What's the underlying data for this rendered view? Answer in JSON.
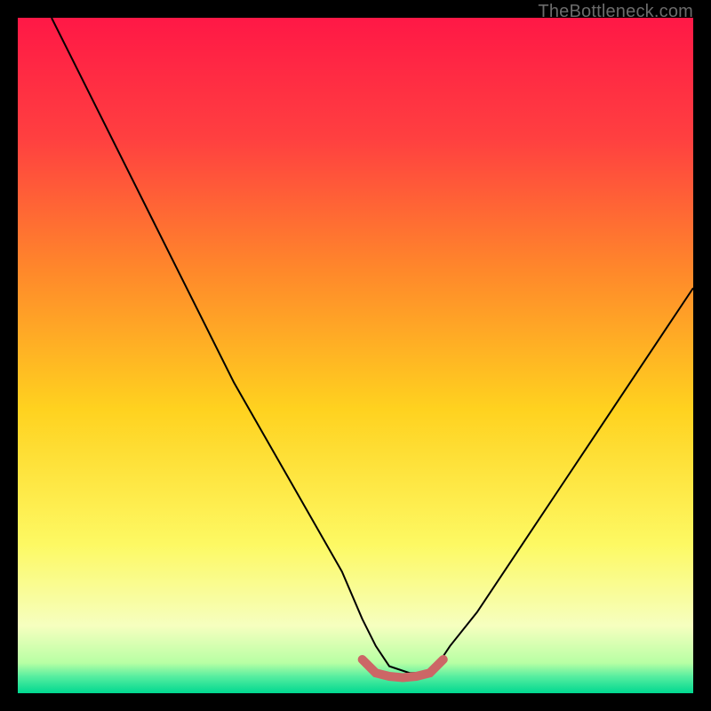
{
  "watermark": "TheBottleneck.com",
  "chart_data": {
    "type": "line",
    "title": "",
    "xlabel": "",
    "ylabel": "",
    "xlim": [
      0,
      100
    ],
    "ylim": [
      0,
      100
    ],
    "grid": false,
    "gradient_stops": [
      {
        "pos": 0.0,
        "color": "#ff1846"
      },
      {
        "pos": 0.18,
        "color": "#ff4040"
      },
      {
        "pos": 0.38,
        "color": "#ff8a2a"
      },
      {
        "pos": 0.58,
        "color": "#ffd21f"
      },
      {
        "pos": 0.78,
        "color": "#fdf963"
      },
      {
        "pos": 0.9,
        "color": "#f6ffbf"
      },
      {
        "pos": 0.955,
        "color": "#b8ffa4"
      },
      {
        "pos": 0.975,
        "color": "#58eea0"
      },
      {
        "pos": 1.0,
        "color": "#00d890"
      }
    ],
    "series": [
      {
        "name": "bottleneck-curve",
        "stroke": "#000000",
        "stroke_width": 2,
        "x": [
          5,
          8,
          12,
          16,
          20,
          24,
          28,
          32,
          36,
          40,
          44,
          48,
          51,
          53,
          55,
          58,
          60,
          62,
          64,
          68,
          72,
          76,
          80,
          84,
          88,
          92,
          96,
          100
        ],
        "values": [
          100,
          94,
          86,
          78,
          70,
          62,
          54,
          46,
          39,
          32,
          25,
          18,
          11,
          7,
          4,
          3,
          3,
          4,
          7,
          12,
          18,
          24,
          30,
          36,
          42,
          48,
          54,
          60
        ]
      },
      {
        "name": "optimal-band",
        "stroke": "#cc6666",
        "stroke_width": 10,
        "linecap": "round",
        "x": [
          51,
          53,
          55,
          57,
          59,
          61,
          63
        ],
        "values": [
          5,
          3,
          2.5,
          2.3,
          2.5,
          3,
          5
        ]
      }
    ]
  }
}
